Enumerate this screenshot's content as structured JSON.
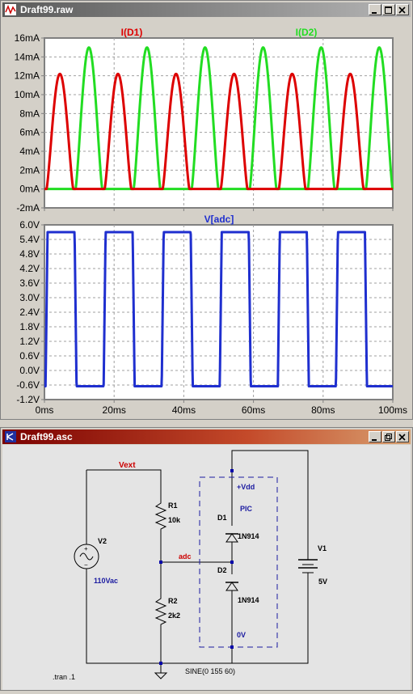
{
  "waveform_window": {
    "title": "Draft99.raw",
    "top_chart": {
      "type": "line",
      "series_labels": [
        "I(D1)",
        "I(D2)"
      ],
      "y_tick_labels": [
        "16mA",
        "14mA",
        "12mA",
        "10mA",
        "8mA",
        "6mA",
        "4mA",
        "2mA",
        "0mA",
        "-2mA"
      ],
      "colors": {
        "d1": "#dd0000",
        "d2": "#22dd22"
      }
    },
    "bottom_chart": {
      "type": "line",
      "series_label": "V[adc]",
      "y_tick_labels": [
        "6.0V",
        "5.4V",
        "4.8V",
        "4.2V",
        "3.6V",
        "3.0V",
        "2.4V",
        "1.8V",
        "1.2V",
        "0.6V",
        "0.0V",
        "-0.6V",
        "-1.2V"
      ],
      "x_tick_labels": [
        "0ms",
        "20ms",
        "40ms",
        "60ms",
        "80ms",
        "100ms"
      ],
      "color": "#1f2fcf"
    }
  },
  "chart_data": [
    {
      "type": "line",
      "title": "",
      "xlabel": "",
      "ylabel": "",
      "xlim": [
        0,
        100
      ],
      "ylim": [
        -2,
        16
      ],
      "x_unit": "ms",
      "y_unit": "mA",
      "grid": true,
      "series": [
        {
          "name": "I(D1)",
          "color": "#dd0000",
          "peak": 12.2,
          "period_ms": 16.67,
          "phase_ms": 0,
          "shape": "half-wave rectified sine"
        },
        {
          "name": "I(D2)",
          "color": "#22dd22",
          "peak": 15.0,
          "period_ms": 16.67,
          "phase_ms": 8.33,
          "shape": "half-wave rectified sine"
        }
      ]
    },
    {
      "type": "line",
      "title": "",
      "xlabel": "",
      "ylabel": "",
      "xlim": [
        0,
        100
      ],
      "ylim": [
        -1.2,
        6.0
      ],
      "x_unit": "ms",
      "y_unit": "V",
      "grid": true,
      "series": [
        {
          "name": "V[adc]",
          "color": "#1f2fcf",
          "high": 5.7,
          "low": -0.65,
          "period_ms": 16.67,
          "shape": "clipped square wave"
        }
      ]
    }
  ],
  "schematic_window": {
    "title": "Draft99.asc",
    "net_labels": {
      "vext": "Vext",
      "adc": "adc",
      "vdd": "+Vdd",
      "zero": "0V",
      "pic": "PIC"
    },
    "components": {
      "r1": {
        "ref": "R1",
        "value": "10k"
      },
      "r2": {
        "ref": "R2",
        "value": "2k2"
      },
      "d1": {
        "ref": "D1",
        "value": "1N914"
      },
      "d2": {
        "ref": "D2",
        "value": "1N914"
      },
      "v1": {
        "ref": "V1",
        "value": "5V"
      },
      "v2": {
        "ref": "V2",
        "value": "110Vac",
        "spice": "SINE(0 155 60)"
      }
    },
    "directive": ".tran .1"
  }
}
